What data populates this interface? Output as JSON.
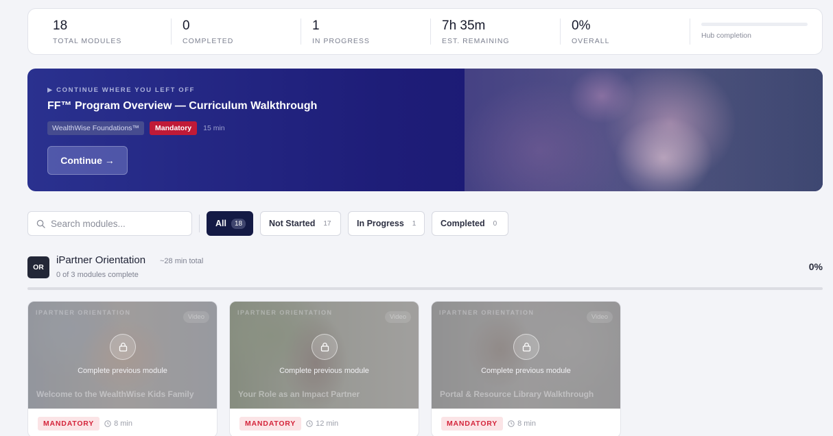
{
  "stats": [
    {
      "value": "18",
      "label": "TOTAL MODULES"
    },
    {
      "value": "0",
      "label": "COMPLETED"
    },
    {
      "value": "1",
      "label": "IN PROGRESS"
    },
    {
      "value": "7h 35m",
      "label": "EST. REMAINING"
    },
    {
      "value": "0%",
      "label": "OVERALL"
    }
  ],
  "hub": {
    "label": "Hub completion",
    "fraction": 0
  },
  "hero": {
    "eyebrow": "CONTINUE WHERE YOU LEFT OFF",
    "title": "FF™ Program Overview — Curriculum Walkthrough",
    "program_tag": "WealthWise Foundations™",
    "mandatory_tag": "Mandatory",
    "duration": "15 min",
    "continue_label": "Continue →"
  },
  "search": {
    "placeholder": "Search modules..."
  },
  "filters": [
    {
      "label": "All",
      "count": "18",
      "active": true
    },
    {
      "label": "Not Started",
      "count": "17",
      "active": false
    },
    {
      "label": "In Progress",
      "count": "1",
      "active": false
    },
    {
      "label": "Completed",
      "count": "0",
      "active": false
    }
  ],
  "section": {
    "badge": "OR",
    "title": "iPartner Orientation",
    "total": "~28 min total",
    "progress_text": "0 of 3 modules complete",
    "percent": "0%"
  },
  "cards": [
    {
      "category": "IPARTNER ORIENTATION",
      "type": "Video",
      "locked_text": "Complete previous module",
      "title": "Welcome to the WealthWise Kids Family",
      "tag": "MANDATORY",
      "duration": "8 min"
    },
    {
      "category": "IPARTNER ORIENTATION",
      "type": "Video",
      "locked_text": "Complete previous module",
      "title": "Your Role as an Impact Partner",
      "tag": "MANDATORY",
      "duration": "12 min"
    },
    {
      "category": "IPARTNER ORIENTATION",
      "type": "Video",
      "locked_text": "Complete previous module",
      "title": "Portal & Resource Library Walkthrough",
      "tag": "MANDATORY",
      "duration": "8 min"
    }
  ]
}
